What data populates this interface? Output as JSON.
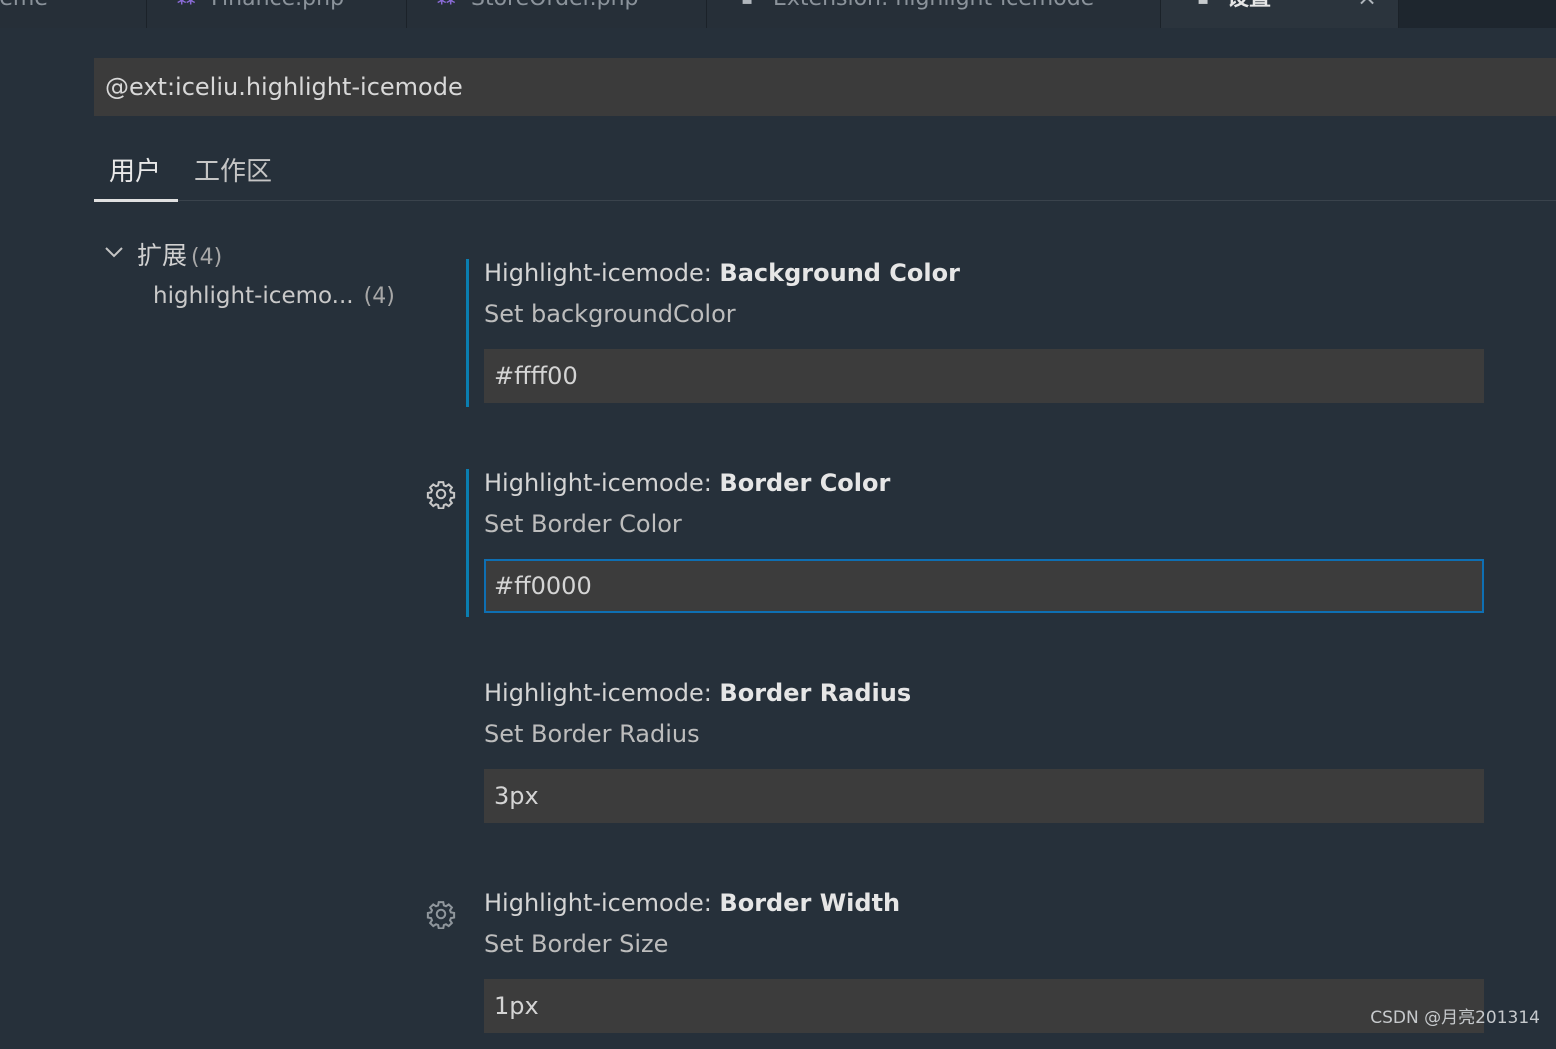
{
  "tabs": [
    {
      "label": "Theme",
      "icon": ""
    },
    {
      "label": "Finance.php",
      "icon": "php-file-icon"
    },
    {
      "label": "StoreOrder.php",
      "icon": "php-file-icon"
    },
    {
      "label": "Extension: highlight-icemode",
      "icon": "extension-icon"
    },
    {
      "label": "设置",
      "icon": "settings-file-icon",
      "active": true
    }
  ],
  "search": {
    "value": "@ext:iceliu.highlight-icemode"
  },
  "scope_tabs": {
    "user": "用户",
    "workspace": "工作区"
  },
  "tree": {
    "group_label": "扩展",
    "group_count": "(4)",
    "item_label": "highlight-icemo...",
    "item_count": "(4)"
  },
  "settings": [
    {
      "category": "Highlight-icemode: ",
      "name": "Background Color",
      "description": "Set backgroundColor",
      "value": "#ffff00"
    },
    {
      "category": "Highlight-icemode: ",
      "name": "Border Color",
      "description": "Set Border Color",
      "value": "#ff0000"
    },
    {
      "category": "Highlight-icemode: ",
      "name": "Border Radius",
      "description": "Set Border Radius",
      "value": "3px"
    },
    {
      "category": "Highlight-icemode: ",
      "name": "Border Width",
      "description": "Set Border Size",
      "value": "1px"
    }
  ],
  "watermark": "CSDN @月亮201314",
  "colors": {
    "background": "#26303a",
    "input_background": "#3c3c3c",
    "focus_border": "#0e6fb3",
    "modified_indicator": "#0a7eb0"
  }
}
